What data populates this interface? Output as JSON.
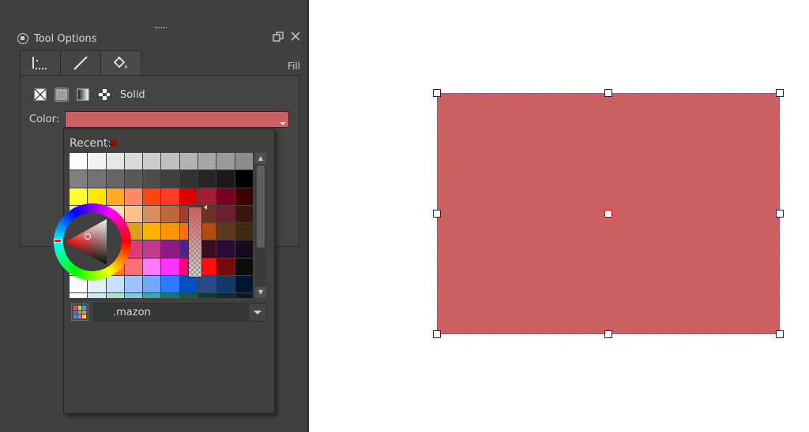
{
  "docker": {
    "title": "Tool Options",
    "float_icon": "float-icon",
    "close_icon": "close-icon",
    "section_label": "Fill",
    "tabs": [
      {
        "name": "tab-selection-options",
        "icon": "dotted-selection-icon",
        "active": false
      },
      {
        "name": "tab-stroke-options",
        "icon": "line-icon",
        "active": false
      },
      {
        "name": "tab-fill-options",
        "icon": "paint-bucket-icon",
        "active": true
      }
    ],
    "fill_types": [
      {
        "name": "no-fill-icon",
        "active": false
      },
      {
        "name": "solid-fill-icon",
        "active": true
      },
      {
        "name": "gradient-fill-icon",
        "active": false
      },
      {
        "name": "pattern-fill-icon",
        "active": false
      }
    ],
    "fill_type_label": "Solid",
    "color_label": "Color:",
    "current_color": "#cc5f5f"
  },
  "color_popup": {
    "recent_label": "Recent:",
    "recent_color": "#8a0f0f",
    "palette_name": ".mazon",
    "swatches": [
      [
        "#ffffff",
        "#f2f2f2",
        "#e6e6e6",
        "#d9d9d9",
        "#cccccc",
        "#bfbfbf",
        "#b3b3b3",
        "#a6a6a6",
        "#999999",
        "#8c8c8c"
      ],
      [
        "#808080",
        "#737373",
        "#666666",
        "#595959",
        "#4d4d4d",
        "#404040",
        "#333333",
        "#262626",
        "#1a1a1a",
        "#000000"
      ],
      [
        "#ffff33",
        "#ffe600",
        "#ffaa22",
        "#ff8866",
        "#ff4411",
        "#ff3b2b",
        "#dd0000",
        "#a81b36",
        "#7a0022",
        "#3d0000"
      ],
      [
        "#f8e4c6",
        "#fde2ad",
        "#ffdcb4",
        "#fdc08b",
        "#d88e5c",
        "#c0673e",
        "#9c402c",
        "#6f3226",
        "#6b2030",
        "#3b1512"
      ],
      [
        "#f3d49a",
        "#d9b98c",
        "#c8b284",
        "#e0a119",
        "#ffb400",
        "#ff9400",
        "#ff6f0a",
        "#b44d0f",
        "#5e3a1d",
        "#3f2a0d"
      ],
      [
        "#ffc3d6",
        "#ff77cc",
        "#ff2a8a",
        "#de3a7a",
        "#c23a8a",
        "#8f1a82",
        "#522090",
        "#3b0c1d",
        "#2b0c37",
        "#1a0a1e"
      ],
      [
        "#ffff77",
        "#ffff00",
        "#ff7e22",
        "#ff6f75",
        "#ff79ff",
        "#ff33ff",
        "#ff0077",
        "#ff1010",
        "#770a0a",
        "#0c0c08"
      ],
      [
        "#fbfbfb",
        "#e0f0ff",
        "#c9def8",
        "#9ec1ff",
        "#72a9ff",
        "#2e7bff",
        "#0050c0",
        "#2b4a8a",
        "#123a66",
        "#001433"
      ],
      [
        "#ffffff",
        "#d0e8f0",
        "#b4e0c8",
        "#7ecbe0",
        "#3ca8b0",
        "#177a70",
        "#1c5a4a",
        "#153b35",
        "#0f2a28",
        "#0a1a1a"
      ]
    ],
    "palette_icon_colors": [
      "#e84a5f",
      "#f6c244",
      "#3aa4e0",
      "#6c5ce7",
      "#55c57a",
      "#ff7f50",
      "#2d98da",
      "#e056fd",
      "#ffd32a"
    ],
    "wheel_hue": "#ff0000",
    "alpha_color": "#cc5f5f"
  },
  "canvas": {
    "shape_fill": "#cc5f5f",
    "shape_border": "#6a5a9a"
  }
}
